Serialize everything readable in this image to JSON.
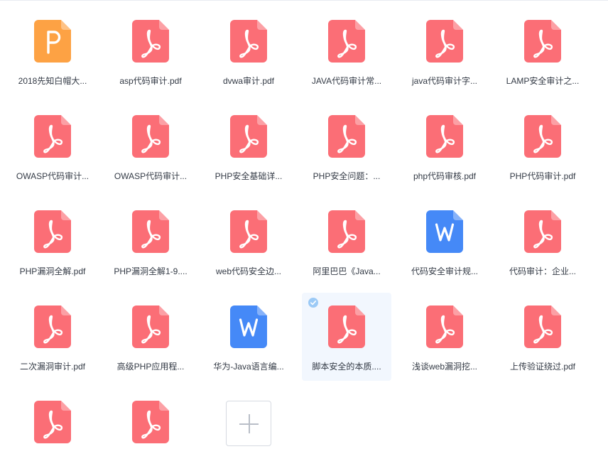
{
  "files": [
    {
      "type": "ppt",
      "name": "2018先知白帽大..."
    },
    {
      "type": "pdf",
      "name": "asp代码审计.pdf"
    },
    {
      "type": "pdf",
      "name": "dvwa审计.pdf"
    },
    {
      "type": "pdf",
      "name": "JAVA代码审计常..."
    },
    {
      "type": "pdf",
      "name": "java代码审计字..."
    },
    {
      "type": "pdf",
      "name": "LAMP安全审计之..."
    },
    {
      "type": "pdf",
      "name": "OWASP代码审计..."
    },
    {
      "type": "pdf",
      "name": "OWASP代码审计..."
    },
    {
      "type": "pdf",
      "name": "PHP安全基础详..."
    },
    {
      "type": "pdf",
      "name": "PHP安全问题：..."
    },
    {
      "type": "pdf",
      "name": "php代码审核.pdf"
    },
    {
      "type": "pdf",
      "name": "PHP代码审计.pdf"
    },
    {
      "type": "pdf",
      "name": "PHP漏洞全解.pdf"
    },
    {
      "type": "pdf",
      "name": "PHP漏洞全解1-9...."
    },
    {
      "type": "pdf",
      "name": "web代码安全边..."
    },
    {
      "type": "pdf",
      "name": "阿里巴巴《Java..."
    },
    {
      "type": "word",
      "name": "代码安全审计规..."
    },
    {
      "type": "pdf",
      "name": "代码审计：企业..."
    },
    {
      "type": "pdf",
      "name": "二次漏洞审计.pdf"
    },
    {
      "type": "pdf",
      "name": "高级PHP应用程..."
    },
    {
      "type": "word",
      "name": "华为-Java语言编..."
    },
    {
      "type": "pdf",
      "name": "脚本安全的本质....",
      "selected": true
    },
    {
      "type": "pdf",
      "name": "浅谈web漏洞挖..."
    },
    {
      "type": "pdf",
      "name": "上传验证绕过.pdf"
    },
    {
      "type": "pdf",
      "name": ""
    },
    {
      "type": "pdf",
      "name": ""
    }
  ],
  "icon_colors": {
    "pdf": "#fb6e76",
    "ppt": "#fda244",
    "word": "#4589f7"
  }
}
